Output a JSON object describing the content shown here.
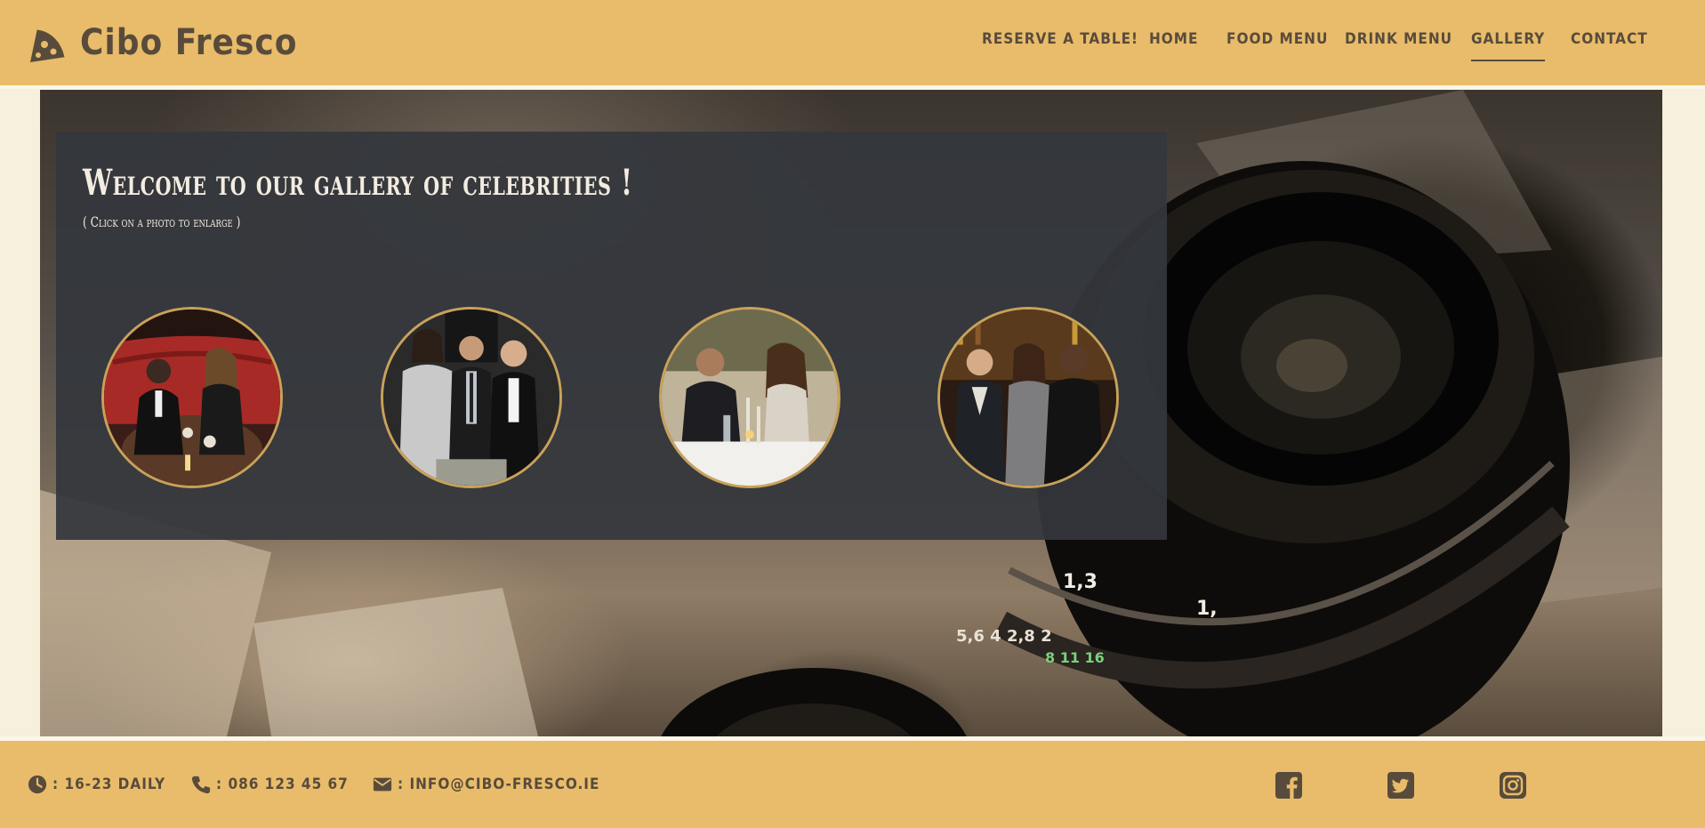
{
  "brand": {
    "name": "Cibo Fresco"
  },
  "nav": {
    "items": [
      {
        "label": "RESERVE A TABLE!"
      },
      {
        "label": "HOME"
      },
      {
        "label": "FOOD MENU"
      },
      {
        "label": "DRINK MENU"
      },
      {
        "label": "GALLERY",
        "active": true
      },
      {
        "label": "CONTACT"
      }
    ]
  },
  "gallery": {
    "title": "Welcome to our gallery of celebrities !",
    "subtitle": "( Click on a photo to enlarge )",
    "photo_count": 4
  },
  "footer": {
    "hours": ": 16-23 DAILY",
    "phone": ": 086 123 45 67",
    "email": ": INFO@CIBO-FRESCO.IE",
    "social": [
      "facebook-icon",
      "twitter-icon",
      "instagram-icon"
    ]
  },
  "colors": {
    "header_bg": "#e8bc6a",
    "text_brown": "#594b3c",
    "page_bg": "#f6f0dc",
    "panel_bg": "#34373c",
    "photo_ring": "#c9a25a"
  }
}
